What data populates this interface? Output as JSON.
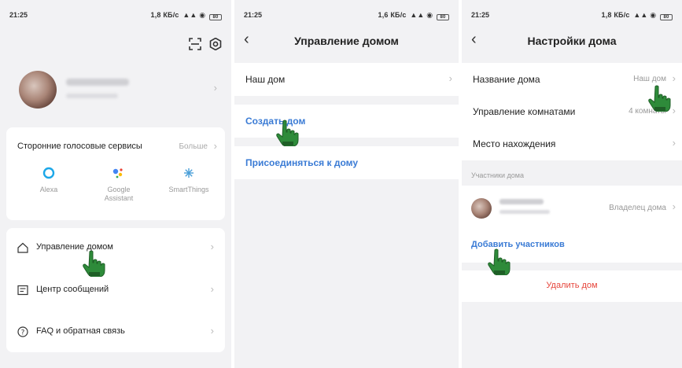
{
  "status": {
    "s1": {
      "time": "21:25",
      "right": "1,8 КБ/с"
    },
    "s2": {
      "time": "21:25",
      "right": "1,6 КБ/с"
    },
    "s3": {
      "time": "21:25",
      "right": "1,8 КБ/с"
    },
    "battery": "80"
  },
  "screen1": {
    "voice": {
      "title": "Сторонние голосовые сервисы",
      "more": "Больше",
      "assistants": [
        {
          "name": "Alexa",
          "icon": "alexa-icon"
        },
        {
          "name": "Google\nAssistant",
          "icon": "google-assistant-icon"
        },
        {
          "name": "SmartThings",
          "icon": "smartthings-icon"
        }
      ]
    },
    "menu": [
      {
        "label": "Управление домом",
        "icon": "home-icon"
      },
      {
        "label": "Центр сообщений",
        "icon": "message-icon"
      },
      {
        "label": "FAQ и обратная связь",
        "icon": "help-icon"
      }
    ]
  },
  "screen2": {
    "title": "Управление домом",
    "home_name": "Наш дом",
    "create_home": "Создать дом",
    "join_home": "Присоединяться к дому"
  },
  "screen3": {
    "title": "Настройки дома",
    "rows": [
      {
        "label": "Название дома",
        "value": "Наш дом"
      },
      {
        "label": "Управление комнатами",
        "value": "4 комнаты"
      },
      {
        "label": "Место нахождения",
        "value": ""
      }
    ],
    "members_label": "Участники дома",
    "member_role": "Владелец дома",
    "add_members": "Добавить участников",
    "delete_home": "Удалить дом"
  },
  "colors": {
    "background": "#f2f2f4",
    "card": "#ffffff",
    "link": "#3a7bd5",
    "danger": "#e6453b",
    "hand": "#2e8b3a"
  }
}
